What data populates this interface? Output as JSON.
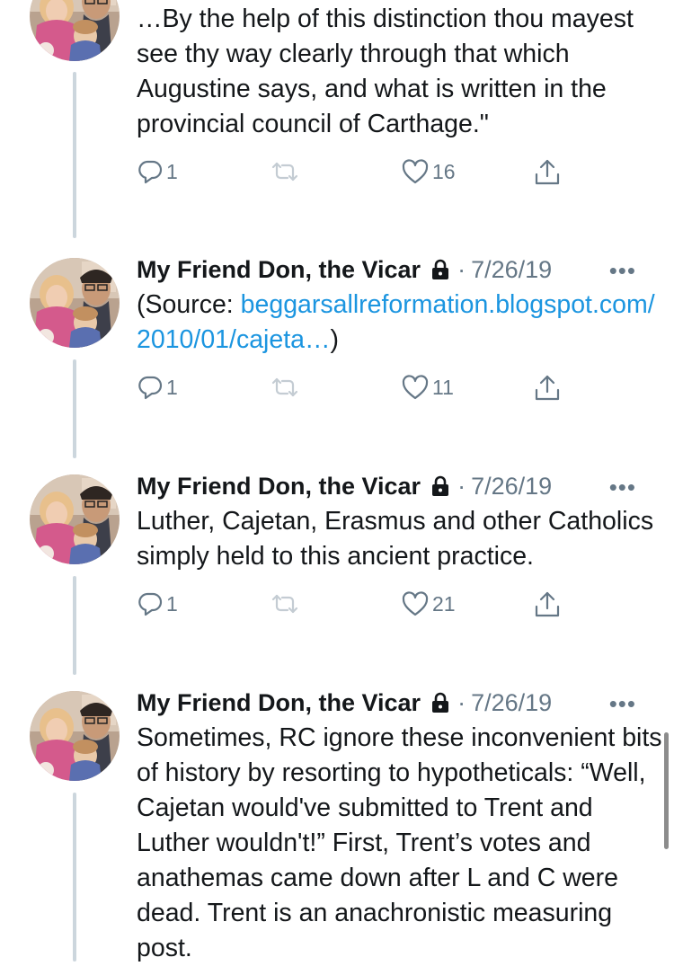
{
  "tweets": [
    {
      "text": "…By the help of this distinction thou mayest see thy way clearly through that which Augustine says, and what is written in the provincial council of Carthage.\"",
      "replies": "1",
      "likes": "16"
    },
    {
      "author": "My Friend Don, the Vicar",
      "sep": "·",
      "date": "7/26/19",
      "text_before": "(Source: ",
      "link": "beggarsallreformation.blogspot.com/\n2010/01/cajeta…",
      "text_after": ")",
      "replies": "1",
      "likes": "11"
    },
    {
      "author": "My Friend Don, the Vicar",
      "sep": "·",
      "date": "7/26/19",
      "text": "Luther, Cajetan, Erasmus and other Catholics simply held to this ancient practice.",
      "replies": "1",
      "likes": "21"
    },
    {
      "author": "My Friend Don, the Vicar",
      "sep": "·",
      "date": "7/26/19",
      "text": "Sometimes, RC ignore these inconvenient bits of history by resorting to hypotheticals: “Well, Cajetan would've submitted to Trent and Luther wouldn't!” First, Trent’s votes and anathemas came down after L and C were dead. Trent is an anachronistic measuring post."
    }
  ],
  "icons": {
    "reply": "reply-icon",
    "retweet": "retweet-icon",
    "like": "heart-icon",
    "share": "share-icon",
    "lock": "lock-icon",
    "more": "more-icon"
  },
  "colors": {
    "link": "#1b95e0",
    "muted": "#657786",
    "retweet_disabled": "#c4ccd3",
    "thread_line": "#ccd6dd"
  }
}
